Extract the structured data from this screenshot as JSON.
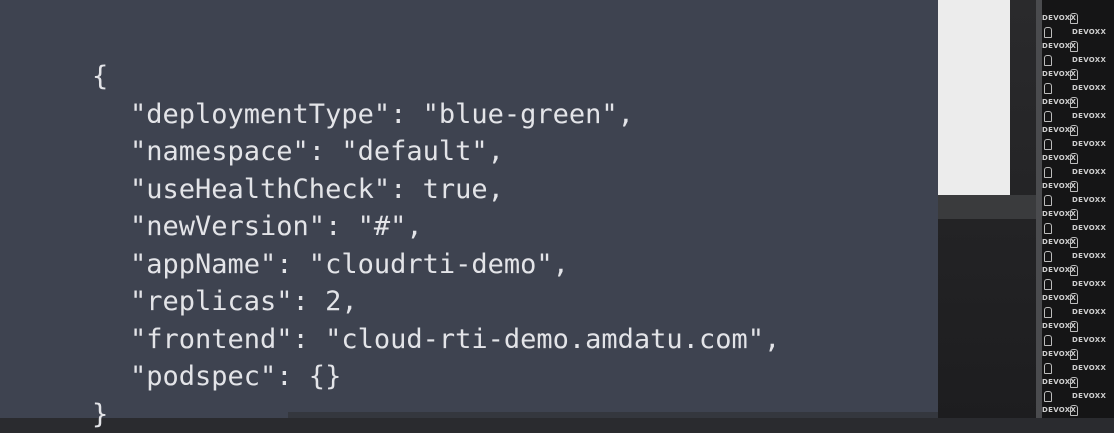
{
  "code": {
    "open_brace": "{",
    "lines": [
      "\"deploymentType\": \"blue-green\",",
      "\"namespace\": \"default\",",
      "\"useHealthCheck\": true,",
      "\"newVersion\": \"#\",",
      "\"appName\": \"cloudrti-demo\",",
      "\"replicas\": 2,",
      "\"frontend\": \"cloud-rti-demo.amdatu.com\",",
      "\"podspec\": {}"
    ],
    "close_brace": "}"
  },
  "backdrop": {
    "logo_text": "DEVOXX"
  },
  "colors": {
    "slide_background": "#3e4350",
    "code_text": "#e3e4e8",
    "backdrop": "#151516"
  }
}
